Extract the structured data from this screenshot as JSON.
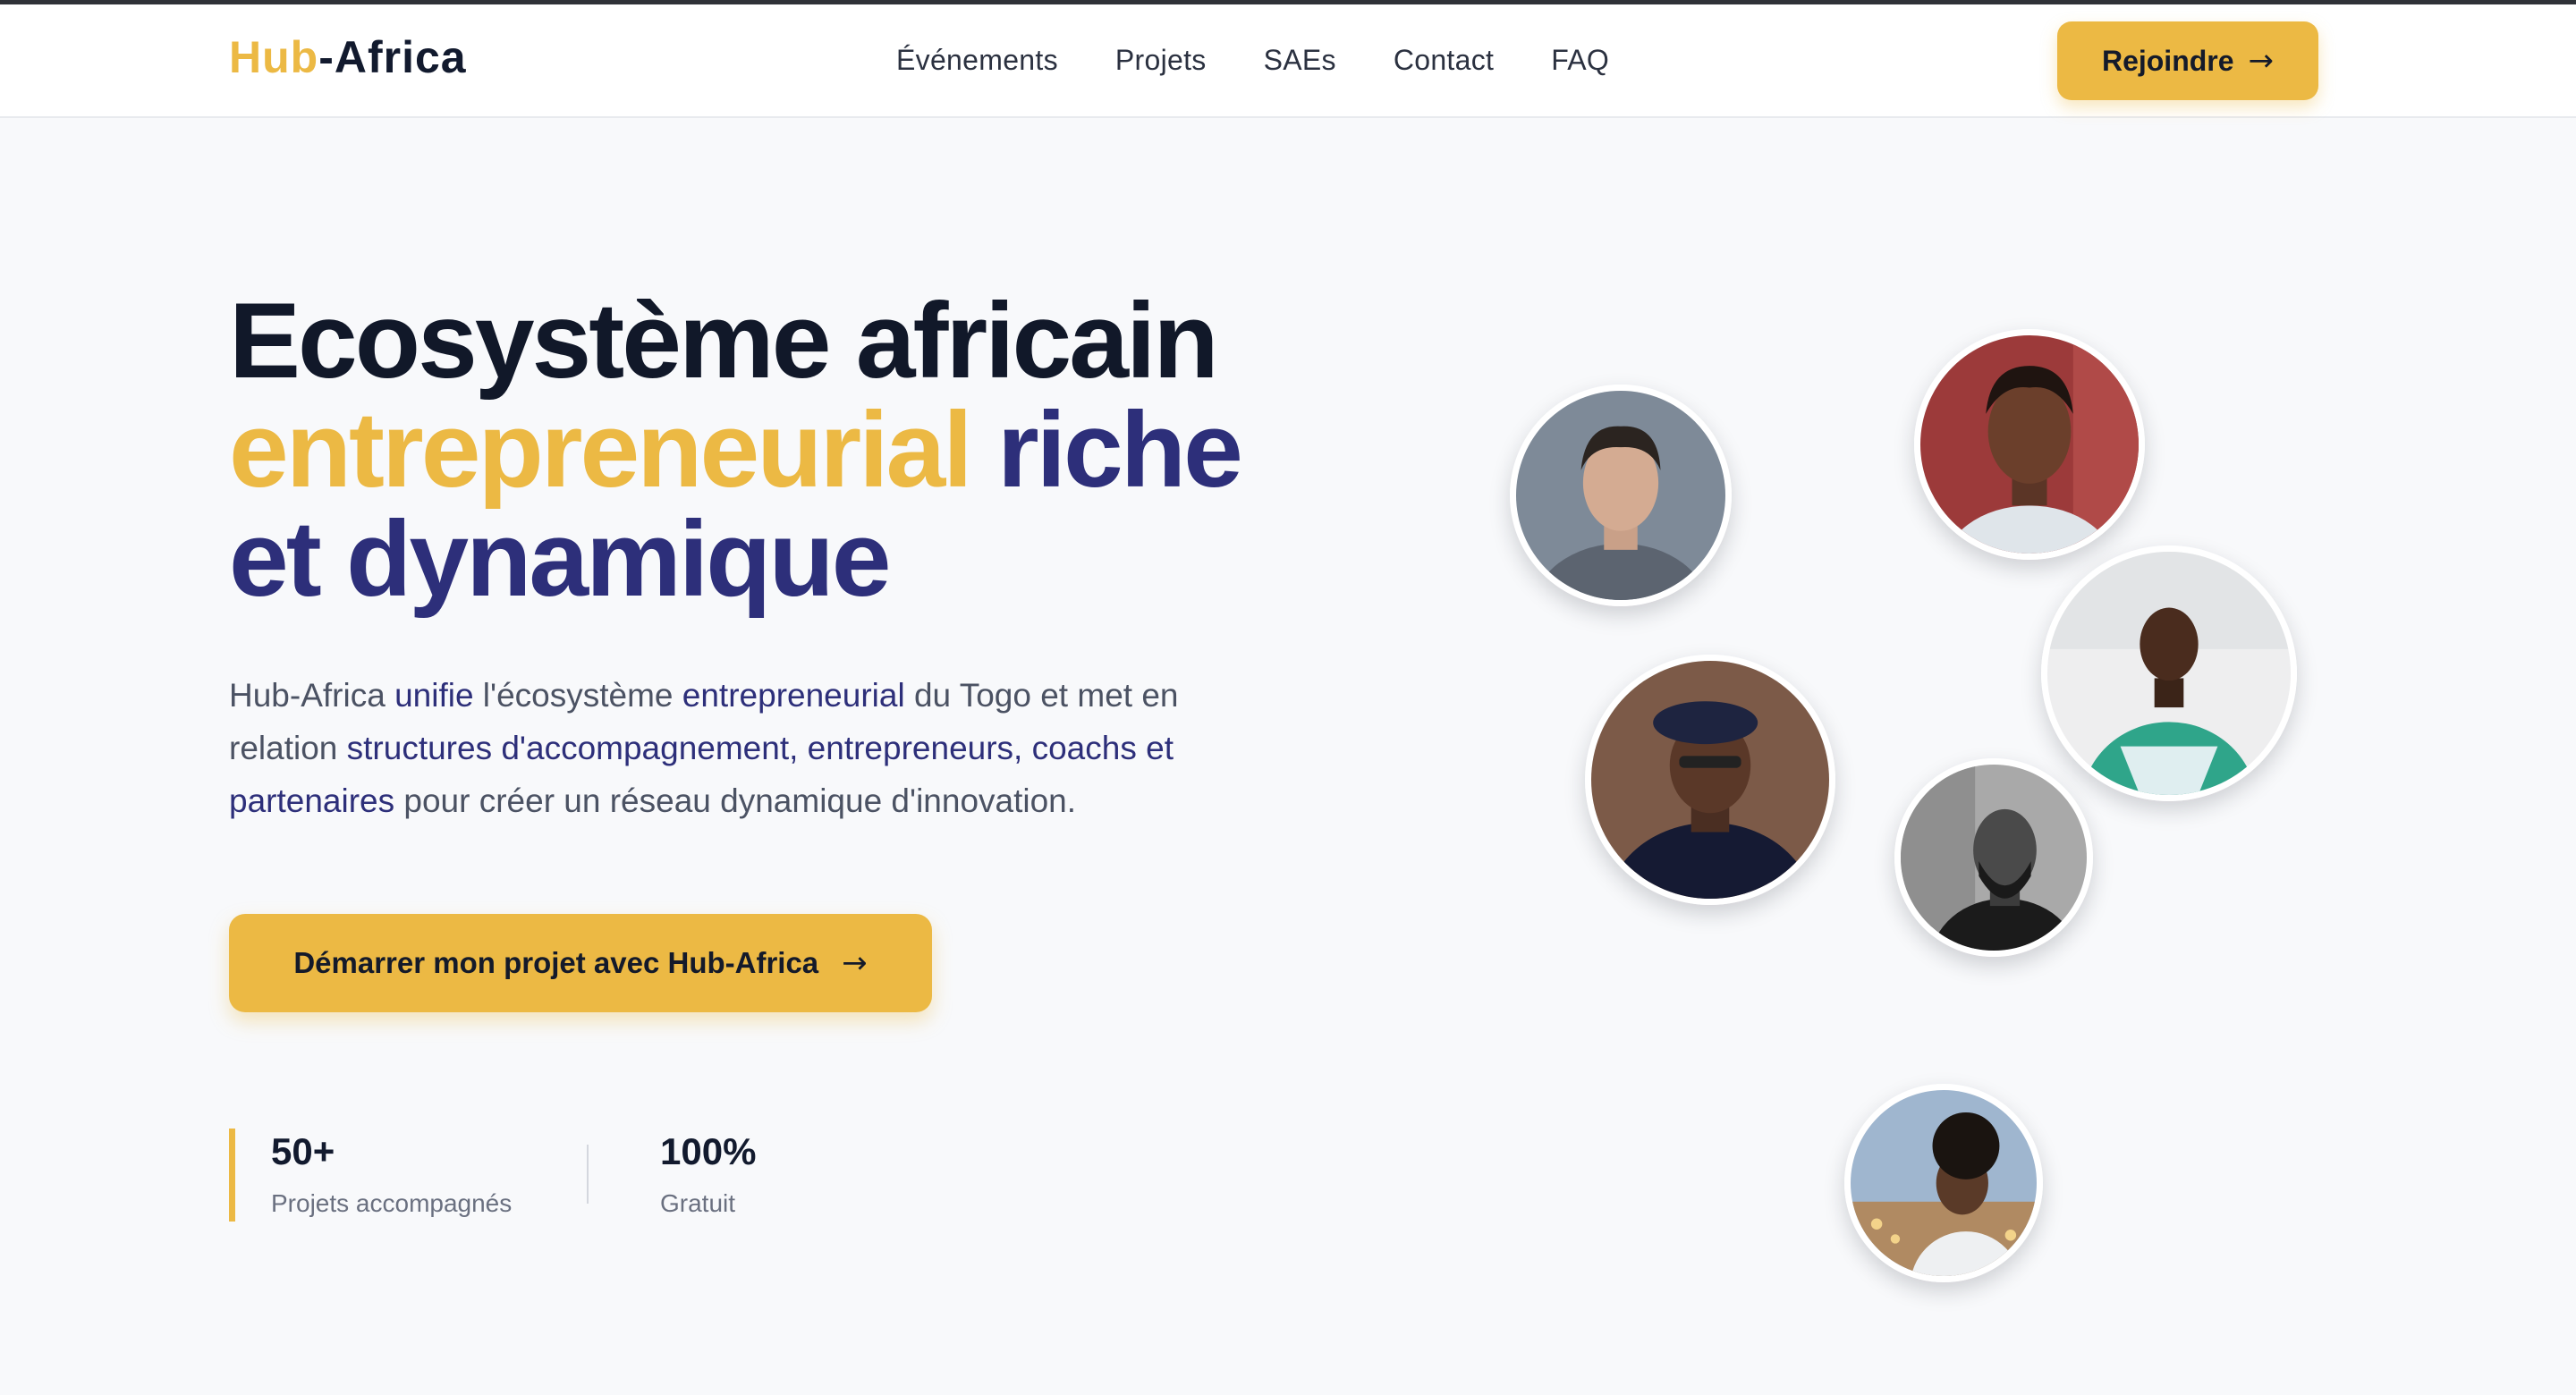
{
  "brand": {
    "prefix": "Hub",
    "suffix": "-Africa"
  },
  "nav": {
    "items": [
      {
        "label": "Événements"
      },
      {
        "label": "Projets"
      },
      {
        "label": "SAEs"
      },
      {
        "label": "Contact"
      },
      {
        "label": "FAQ"
      }
    ],
    "join_label": "Rejoindre"
  },
  "hero": {
    "title_line1": "Ecosystème africain",
    "title_gold": "entrepreneurial",
    "title_rest": "riche",
    "title_line3": "et dynamique",
    "desc": {
      "p1": "Hub-Africa ",
      "h1": "unifie",
      "p2": " l'écosystème ",
      "h2": "entrepreneurial",
      "p3": " du Togo et met en relation ",
      "h3": "structures d'accompagnement, entrepreneurs, coachs et partenaires",
      "p4": " pour créer un réseau dynamique d'innovation."
    },
    "cta_label": "Démarrer mon projet avec Hub-Africa"
  },
  "stats": [
    {
      "value": "50+",
      "label": "Projets accompagnés"
    },
    {
      "value": "100%",
      "label": "Gratuit"
    }
  ],
  "icons": {
    "arrow": "→"
  },
  "colors": {
    "accent": "#ecb944",
    "navy": "#2d2f7a",
    "dark": "#111829"
  }
}
